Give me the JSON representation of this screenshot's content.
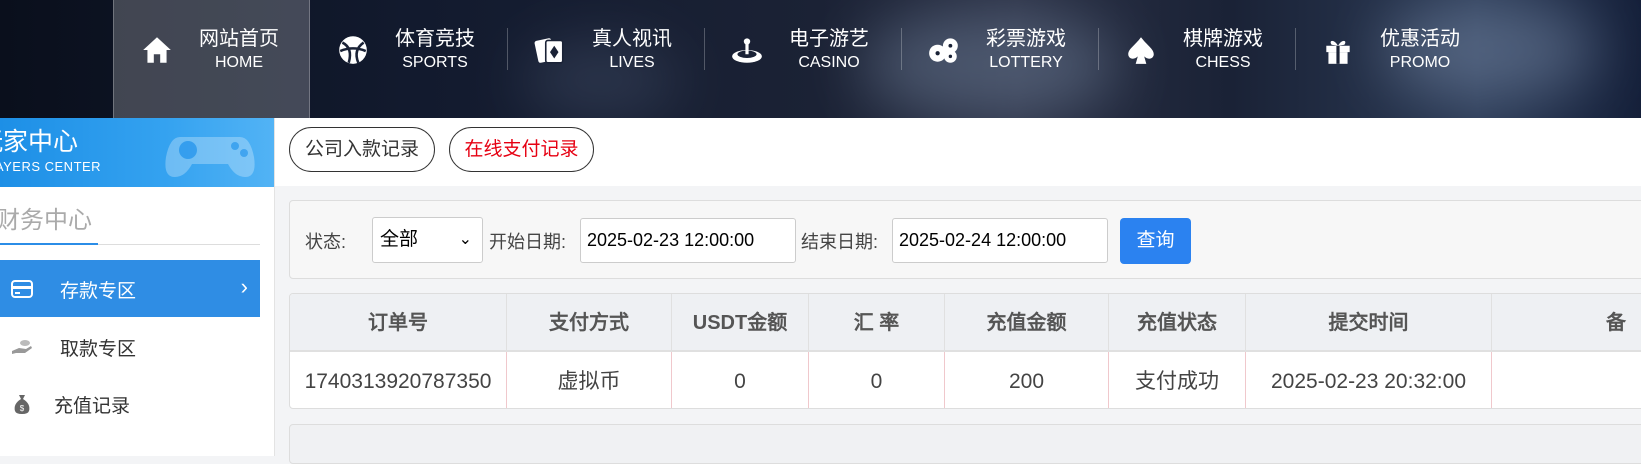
{
  "nav": {
    "items": [
      {
        "cn": "网站首页",
        "en": "HOME",
        "icon": "home-icon"
      },
      {
        "cn": "体育竞技",
        "en": "SPORTS",
        "icon": "ball-icon"
      },
      {
        "cn": "真人视讯",
        "en": "LIVES",
        "icon": "cards-icon"
      },
      {
        "cn": "电子游艺",
        "en": "CASINO",
        "icon": "roulette-icon"
      },
      {
        "cn": "彩票游戏",
        "en": "LOTTERY",
        "icon": "dice-icon"
      },
      {
        "cn": "棋牌游戏",
        "en": "CHESS",
        "icon": "spade-icon"
      },
      {
        "cn": "优惠活动",
        "en": "PROMO",
        "icon": "gift-icon"
      }
    ]
  },
  "sidebar": {
    "banner_title": "玩家中心",
    "banner_sub": "PLAYERS CENTER",
    "section_title": "财务中心",
    "items": [
      {
        "label": "存款专区",
        "icon": "card-icon"
      },
      {
        "label": "取款专区",
        "icon": "hand-coin-icon"
      },
      {
        "label": "充值记录",
        "icon": "money-bag-icon"
      }
    ]
  },
  "tabs": {
    "company": "公司入款记录",
    "online": "在线支付记录"
  },
  "filter": {
    "status_label": "状态:",
    "status_value": "全部",
    "start_label": "开始日期:",
    "start_value": "2025-02-23 12:00:00",
    "end_label": "结束日期:",
    "end_value": "2025-02-24 12:00:00",
    "query": "查询"
  },
  "table": {
    "headers": [
      "订单号",
      "支付方式",
      "USDT金额",
      "汇 率",
      "充值金额",
      "充值状态",
      "提交时间",
      "备"
    ],
    "rows": [
      [
        "1740313920787350",
        "虚拟币",
        "0",
        "0",
        "200",
        "支付成功",
        "2025-02-23 20:32:00",
        ""
      ]
    ]
  },
  "colors": {
    "active_blue": "#2f8de4",
    "query_blue": "#2b82f0",
    "online_tab_red": "#e60012"
  }
}
